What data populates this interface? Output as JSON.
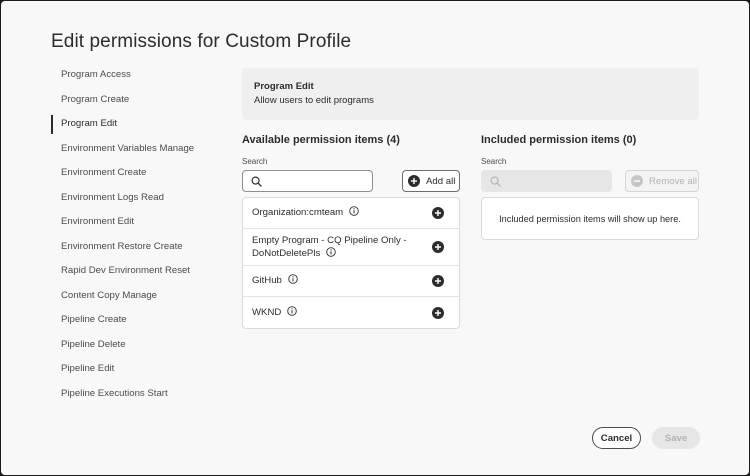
{
  "dialog": {
    "title": "Edit permissions for Custom Profile"
  },
  "nav": {
    "selected_index": 2,
    "items": [
      "Program Access",
      "Program Create",
      "Program Edit",
      "Environment Variables Manage",
      "Environment Create",
      "Environment Logs Read",
      "Environment Edit",
      "Environment Restore Create",
      "Rapid Dev Environment Reset",
      "Content Copy Manage",
      "Pipeline Create",
      "Pipeline Delete",
      "Pipeline Edit",
      "Pipeline Executions Start"
    ]
  },
  "info": {
    "heading": "Program Edit",
    "description": "Allow users to edit programs"
  },
  "available": {
    "heading": "Available permission items (4)",
    "search_label": "Search",
    "search_value": "",
    "add_all_label": "Add all",
    "items": [
      {
        "label": "Organization:cmteam"
      },
      {
        "label": "Empty Program - CQ Pipeline Only - DoNotDeletePls"
      },
      {
        "label": "GitHub"
      },
      {
        "label": "WKND"
      }
    ]
  },
  "included": {
    "heading": "Included permission items (0)",
    "search_label": "Search",
    "search_value": "",
    "remove_all_label": "Remove all",
    "empty_text": "Included permission items will show up here."
  },
  "footer": {
    "cancel_label": "Cancel",
    "save_label": "Save"
  },
  "colors": {
    "text": "#2c2c2c",
    "dialog_bg": "#f8f8f8",
    "disabled": "#b3b3b3"
  },
  "icons": {
    "search": "search-icon",
    "add": "add-circle-icon",
    "remove": "remove-circle-icon",
    "info": "info-icon"
  }
}
